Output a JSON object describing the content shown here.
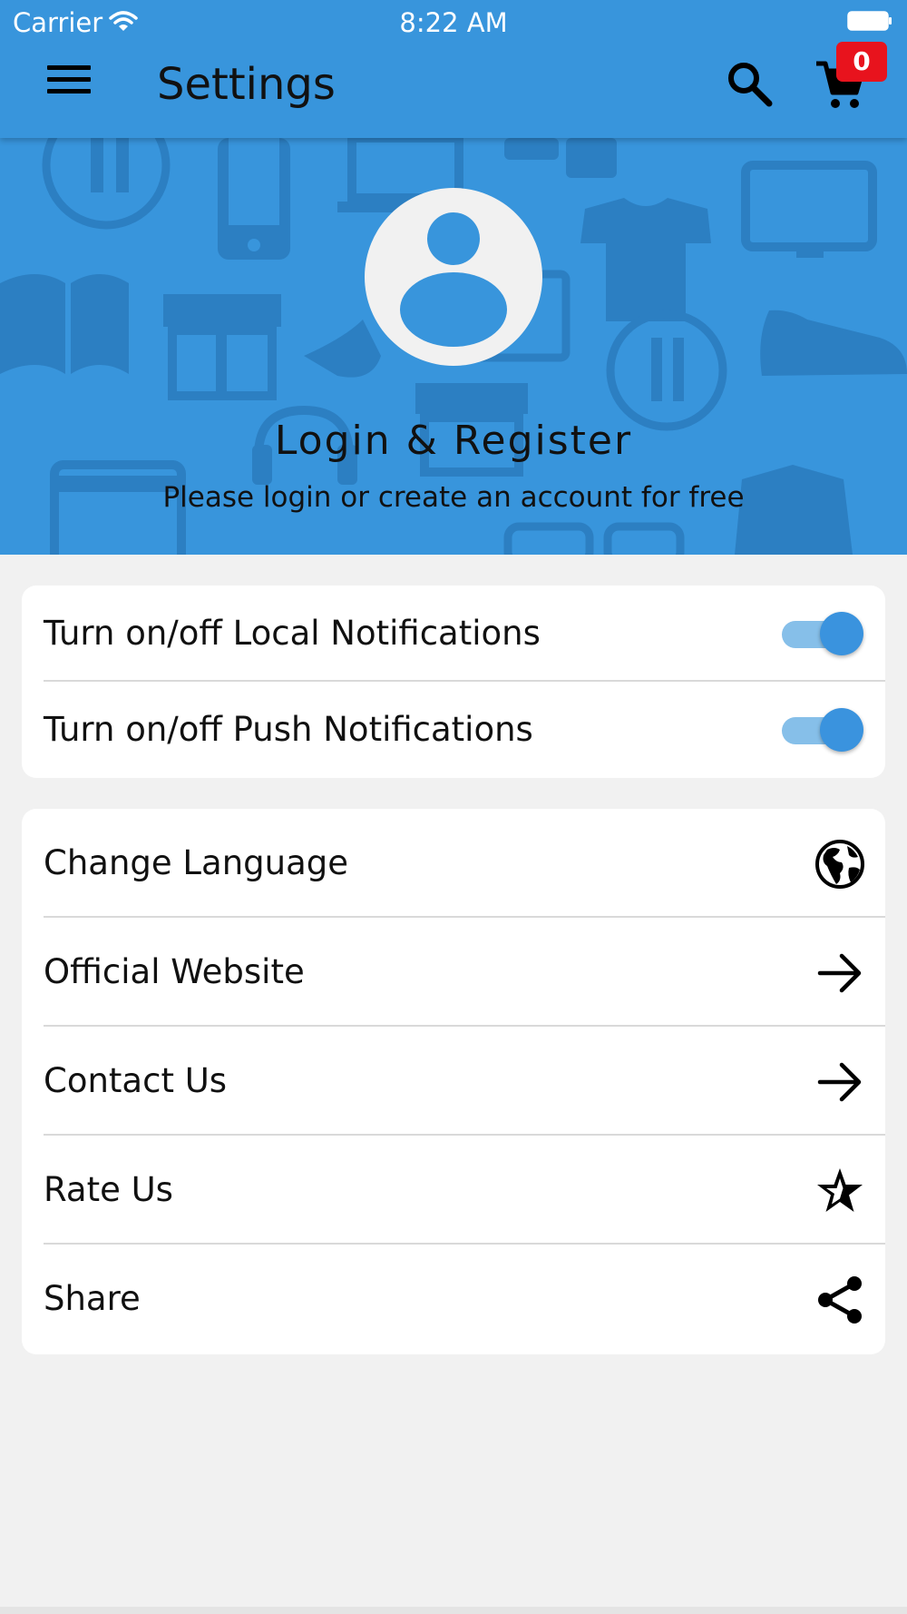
{
  "status_bar": {
    "carrier": "Carrier",
    "time": "8:22 AM"
  },
  "app_bar": {
    "title": "Settings",
    "cart_count": "0"
  },
  "profile": {
    "title": "Login & Register",
    "subtitle": "Please login or create an account for free"
  },
  "notifications": [
    {
      "label": "Turn on/off Local Notifications",
      "enabled": true
    },
    {
      "label": "Turn on/off Push Notifications",
      "enabled": true
    }
  ],
  "menu_items": [
    {
      "label": "Change Language",
      "icon": "globe-icon"
    },
    {
      "label": "Official Website",
      "icon": "arrow-right-icon"
    },
    {
      "label": "Contact Us",
      "icon": "arrow-right-icon"
    },
    {
      "label": "Rate Us",
      "icon": "star-icon"
    },
    {
      "label": "Share",
      "icon": "share-icon"
    }
  ],
  "colors": {
    "primary": "#3895dc",
    "badge": "#e8131d",
    "toggle_track": "#86bfe9",
    "toggle_knob": "#3a93de",
    "page_background": "#f1f1f1"
  }
}
